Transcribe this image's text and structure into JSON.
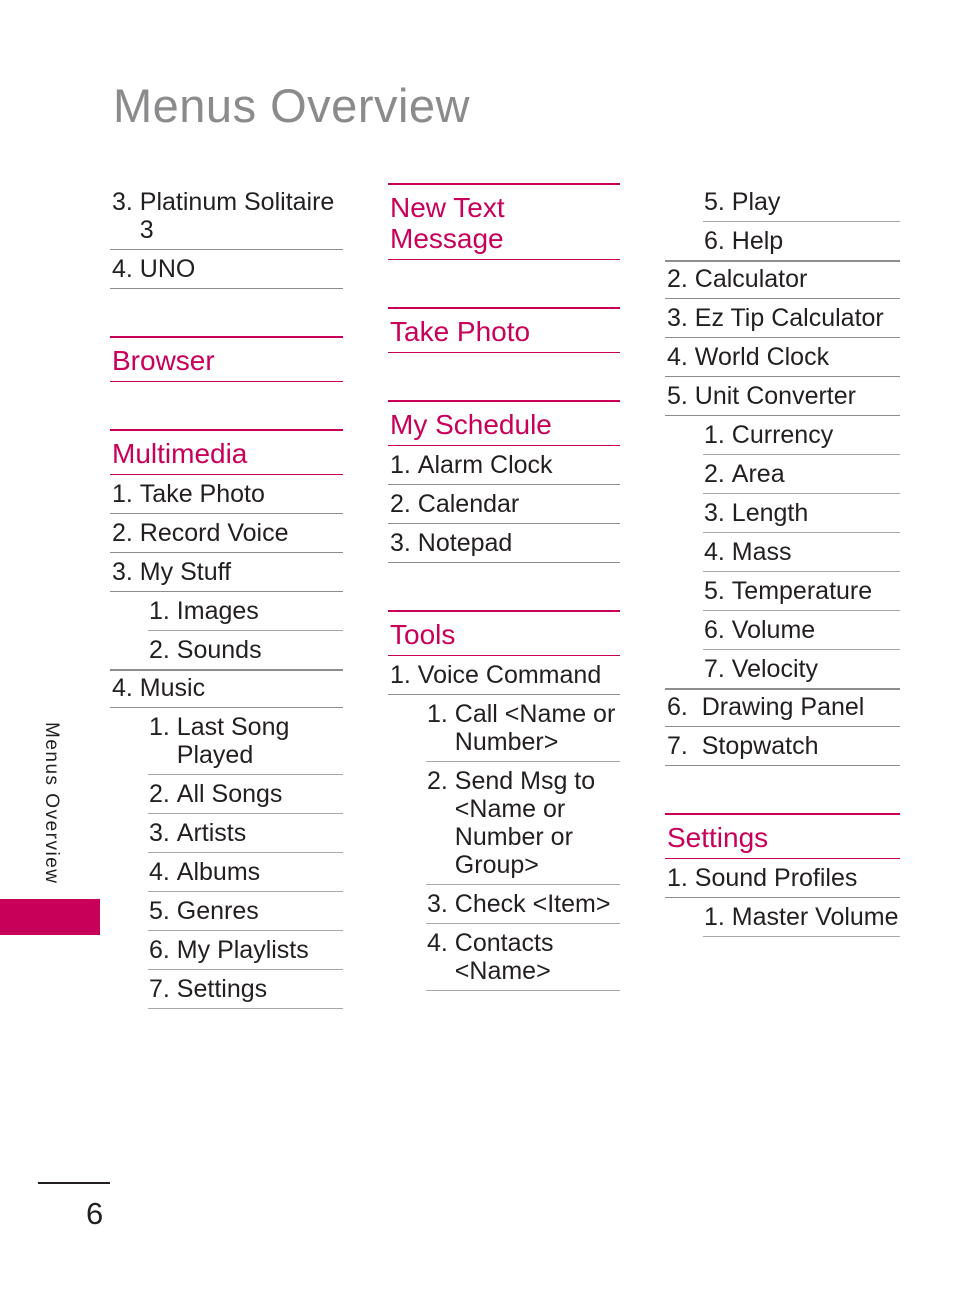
{
  "page": {
    "title": "Menus Overview",
    "side_tab_label": "Menus Overview",
    "page_number": "6",
    "accent_color": "#c8005a",
    "title_color": "#8b8b8e",
    "text_color": "#231f20"
  },
  "columns": [
    {
      "id": "column-1",
      "blocks": [
        {
          "type": "items",
          "items": [
            {
              "num": "3.",
              "text": "Platinum Solitaire 3",
              "level": 1
            },
            {
              "num": "4.",
              "text": "UNO",
              "level": 1
            }
          ]
        },
        {
          "type": "heading",
          "heading": "Browser",
          "items": []
        },
        {
          "type": "heading",
          "heading": "Multimedia",
          "items": [
            {
              "num": "1.",
              "text": "Take Photo",
              "level": 1
            },
            {
              "num": "2.",
              "text": "Record Voice",
              "level": 1
            },
            {
              "num": "3.",
              "text": "My Stuff",
              "level": 1
            },
            {
              "num": "1.",
              "text": "Images",
              "level": 2
            },
            {
              "num": "2.",
              "text": "Sounds",
              "level": 2
            },
            {
              "num": "4.",
              "text": "Music",
              "level": 1
            },
            {
              "num": "1.",
              "text": "Last Song Played",
              "level": 2
            },
            {
              "num": "2.",
              "text": "All Songs",
              "level": 2
            },
            {
              "num": "3.",
              "text": "Artists",
              "level": 2
            },
            {
              "num": "4.",
              "text": "Albums",
              "level": 2
            },
            {
              "num": "5.",
              "text": "Genres",
              "level": 2
            },
            {
              "num": "6.",
              "text": "My Playlists",
              "level": 2
            },
            {
              "num": "7.",
              "text": "Settings",
              "level": 2
            }
          ]
        }
      ]
    },
    {
      "id": "column-2",
      "blocks": [
        {
          "type": "heading",
          "heading": "New Text Message",
          "items": []
        },
        {
          "type": "heading",
          "heading": "Take Photo",
          "items": []
        },
        {
          "type": "heading",
          "heading": "My Schedule",
          "items": [
            {
              "num": "1.",
              "text": "Alarm Clock",
              "level": 1
            },
            {
              "num": "2.",
              "text": "Calendar",
              "level": 1
            },
            {
              "num": "3.",
              "text": "Notepad",
              "level": 1
            }
          ]
        },
        {
          "type": "heading",
          "heading": "Tools",
          "items": [
            {
              "num": "1.",
              "text": "Voice Command",
              "level": 1
            },
            {
              "num": "1.",
              "text": "Call <Name or Number>",
              "level": 2
            },
            {
              "num": "2.",
              "text": "Send Msg to <Name or Number or Group>",
              "level": 2
            },
            {
              "num": "3.",
              "text": "Check <Item>",
              "level": 2
            },
            {
              "num": "4.",
              "text": "Contacts <Name>",
              "level": 2
            }
          ]
        }
      ]
    },
    {
      "id": "column-3",
      "blocks": [
        {
          "type": "items",
          "items": [
            {
              "num": "5.",
              "text": "Play",
              "level": 2
            },
            {
              "num": "6.",
              "text": "Help",
              "level": 2
            },
            {
              "num": "2.",
              "text": "Calculator",
              "level": 1
            },
            {
              "num": "3.",
              "text": "Ez Tip Calculator",
              "level": 1
            },
            {
              "num": "4.",
              "text": "World Clock",
              "level": 1
            },
            {
              "num": "5.",
              "text": "Unit Converter",
              "level": 1
            },
            {
              "num": "1.",
              "text": "Currency",
              "level": 2
            },
            {
              "num": "2.",
              "text": "Area",
              "level": 2
            },
            {
              "num": "3.",
              "text": "Length",
              "level": 2
            },
            {
              "num": "4.",
              "text": "Mass",
              "level": 2
            },
            {
              "num": "5.",
              "text": "Temperature",
              "level": 2
            },
            {
              "num": "6.",
              "text": "Volume",
              "level": 2
            },
            {
              "num": "7.",
              "text": "Velocity",
              "level": 2
            },
            {
              "num": "6. ",
              "text": "Drawing Panel",
              "level": 1
            },
            {
              "num": "7. ",
              "text": "Stopwatch",
              "level": 1
            }
          ]
        },
        {
          "type": "heading",
          "heading": "Settings",
          "items": [
            {
              "num": "1.",
              "text": "Sound Profiles",
              "level": 1
            },
            {
              "num": "1.",
              "text": "Master Volume",
              "level": 2
            }
          ]
        }
      ]
    }
  ]
}
